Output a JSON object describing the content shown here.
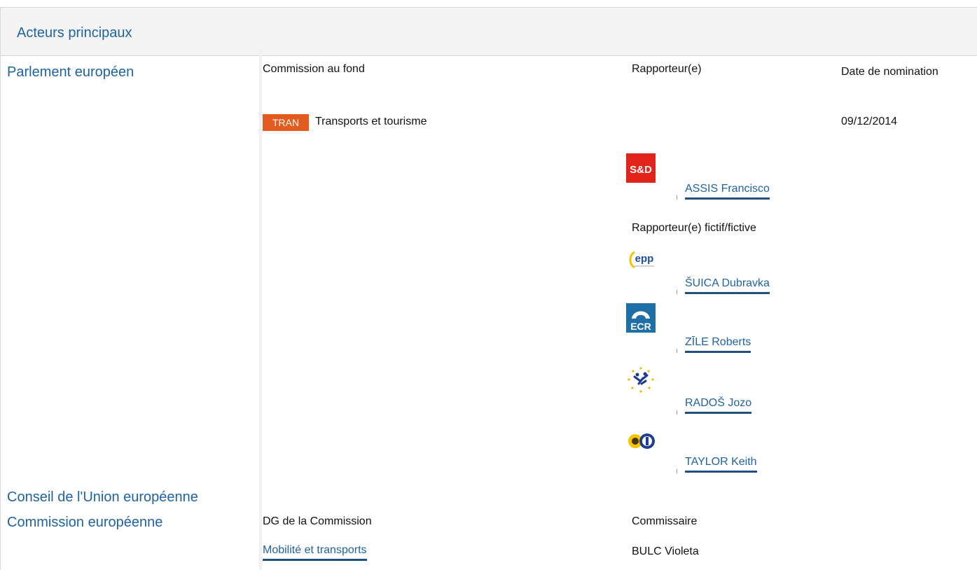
{
  "panel": {
    "title": "Acteurs principaux"
  },
  "institutions": {
    "parliament": "Parlement européen",
    "council": "Conseil de l'Union européenne",
    "commission": "Commission européenne"
  },
  "parliament": {
    "headers": {
      "committee": "Commission au fond",
      "rapporteur": "Rapporteur(e)",
      "date": "Date de nomination"
    },
    "committee": {
      "badge": "TRAN",
      "badge_color": "#e35b1e",
      "name": "Transports et tourisme",
      "date": "09/12/2014"
    },
    "rapporteur": {
      "logo": "S&D",
      "name": "ASSIS Francisco"
    },
    "shadow_label": "Rapporteur(e) fictif/fictive",
    "shadows": [
      {
        "logo": "epp",
        "name": "ŠUICA Dubravka"
      },
      {
        "logo": "ECR",
        "name": "ZĪLE Roberts"
      },
      {
        "logo": "efdd-logo",
        "name": "RADOŠ Jozo"
      },
      {
        "logo": "greens-efa-logo",
        "name": "TAYLOR Keith"
      }
    ]
  },
  "commission": {
    "headers": {
      "dg": "DG de la Commission",
      "commissioner": "Commissaire"
    },
    "dg": "Mobilité et transports",
    "commissioner": "BULC Violeta"
  }
}
